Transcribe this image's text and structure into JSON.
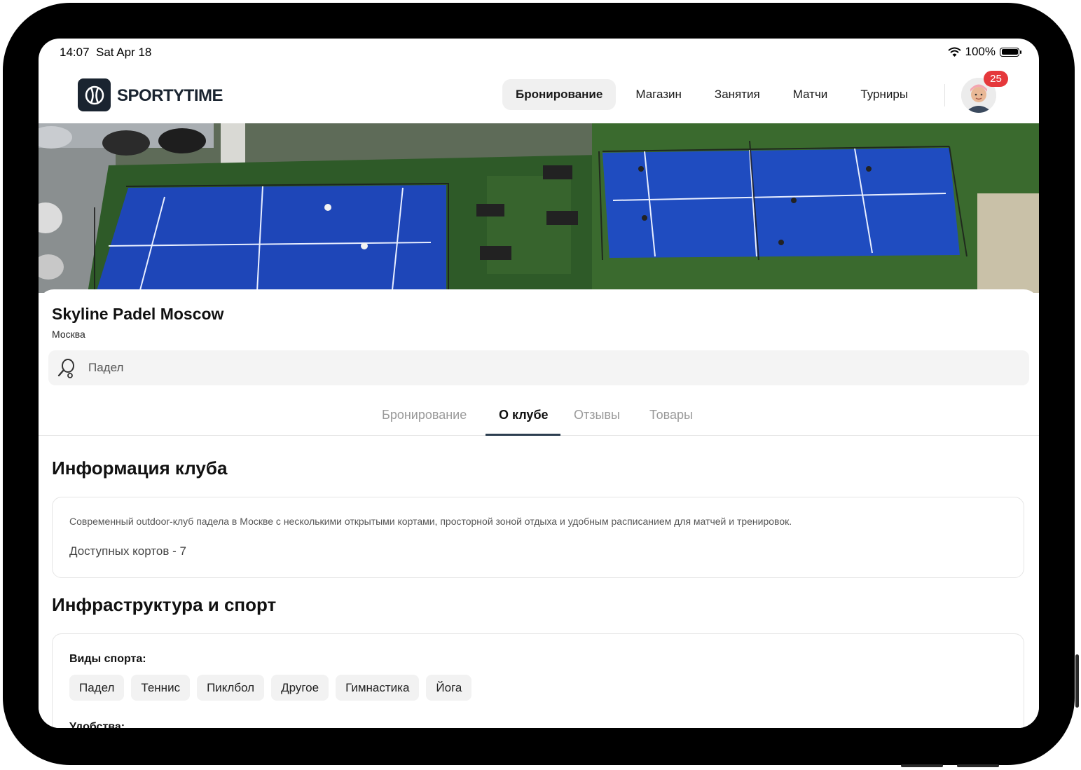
{
  "status_bar": {
    "time": "14:07",
    "date": "Sat Apr 18",
    "battery": "100%",
    "wifi_icon": "wifi-icon",
    "battery_icon": "battery-icon"
  },
  "header": {
    "logo_text": "SPORTYTIME",
    "logo_icon": "tennis-ball-icon",
    "nav": [
      {
        "label": "Бронирование",
        "active": true
      },
      {
        "label": "Магазин"
      },
      {
        "label": "Занятия"
      },
      {
        "label": "Матчи"
      },
      {
        "label": "Турниры"
      }
    ],
    "notification_count": "25"
  },
  "club": {
    "name": "Skyline Padel Moscow",
    "city": "Москва",
    "sport_selector": {
      "value": "Падел",
      "icon": "padel-racket-icon"
    }
  },
  "tabs": [
    {
      "label": "Бронирование"
    },
    {
      "label": "О клубе",
      "active": true
    },
    {
      "label": "Отзывы"
    },
    {
      "label": "Товары"
    }
  ],
  "info": {
    "title": "Информация клуба",
    "description": "Современный outdoor-клуб падела в Москве с несколькими открытыми кортами, просторной зоной отдыха и удобным расписанием для матчей и тренировок.",
    "courts": "Доступных кортов - 7"
  },
  "infrastructure": {
    "title": "Инфраструктура и спорт",
    "sports_label": "Виды спорта:",
    "sports": [
      "Падел",
      "Теннис",
      "Пиклбол",
      "Другое",
      "Гимнастика",
      "Йога"
    ],
    "next_label": "Удобства:"
  },
  "colors": {
    "accent": "#2c3e50",
    "badge": "#e5383b",
    "court_blue": "#1e46b8",
    "turf_green": "#3f6a2c"
  }
}
